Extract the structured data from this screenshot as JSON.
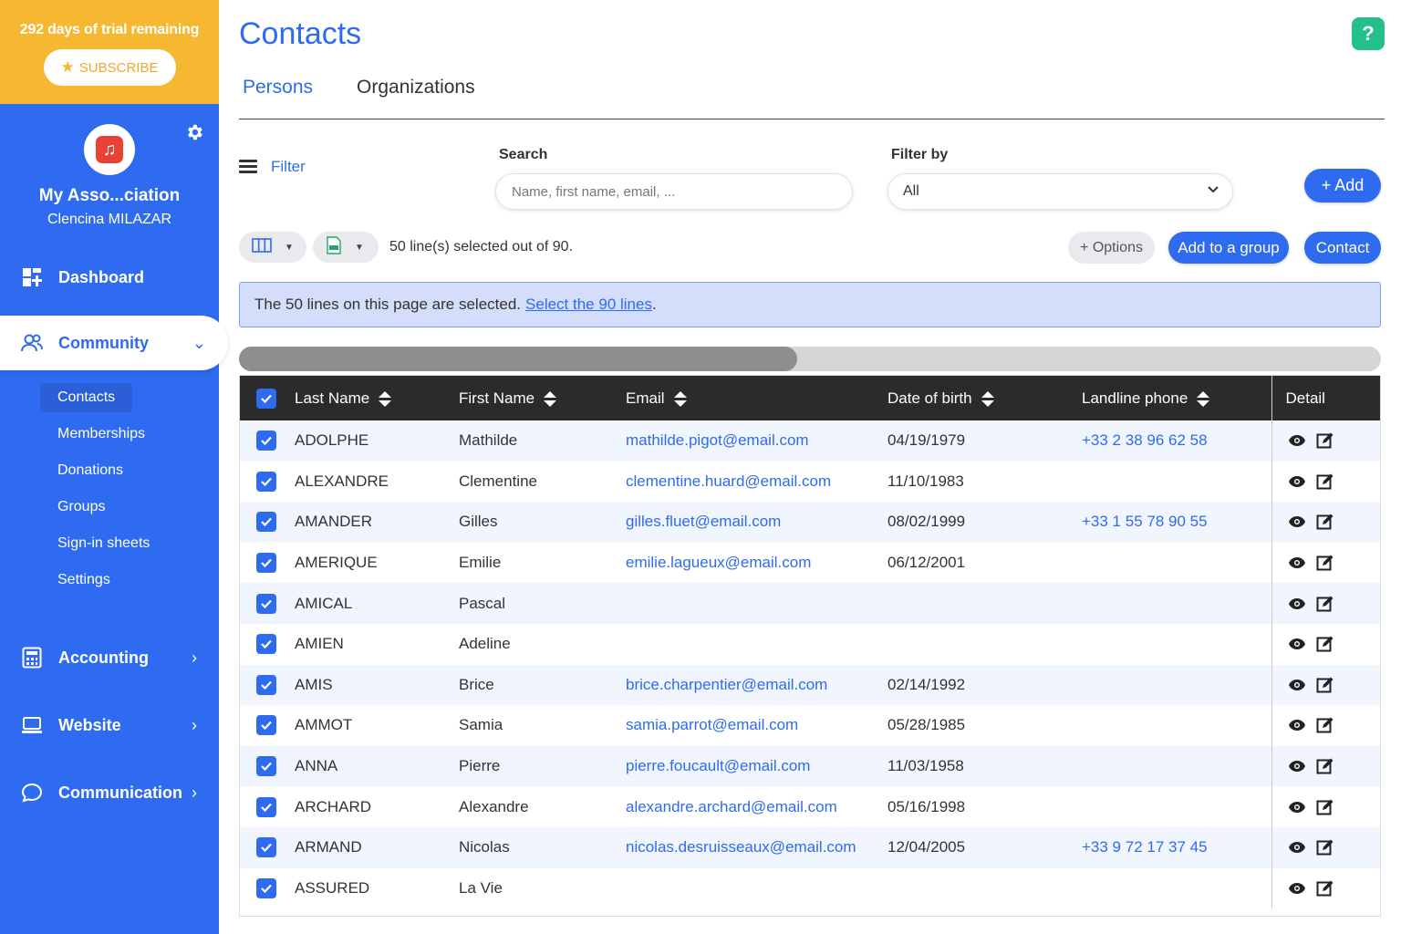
{
  "sidebar": {
    "trial_text": "292 days of trial remaining",
    "subscribe_label": "SUBSCRIBE",
    "org_name": "My Asso...ciation",
    "org_user": "Clencina MILAZAR",
    "nav": {
      "dashboard": "Dashboard",
      "community": "Community",
      "accounting": "Accounting",
      "website": "Website",
      "communication": "Communication"
    },
    "community_items": [
      "Contacts",
      "Memberships",
      "Donations",
      "Groups",
      "Sign-in sheets",
      "Settings"
    ]
  },
  "header": {
    "title": "Contacts",
    "help_label": "?",
    "tabs": [
      "Persons",
      "Organizations"
    ]
  },
  "filters": {
    "filter_label": "Filter",
    "search_label": "Search",
    "search_placeholder": "Name, first name, email, ...",
    "filter_by_label": "Filter by",
    "filter_by_value": "All",
    "add_label": "+ Add"
  },
  "toolbar": {
    "selection_text": "50 line(s) selected out of 90.",
    "options_label": "+ Options",
    "add_to_group_label": "Add to a group",
    "contact_label": "Contact"
  },
  "banner": {
    "text": "The 50 lines on this page are selected.",
    "link": "Select the 90 lines"
  },
  "table": {
    "headers": [
      "Last Name",
      "First Name",
      "Email",
      "Date of birth",
      "Landline phone",
      "Detail"
    ],
    "rows": [
      {
        "last": "ADOLPHE",
        "first": "Mathilde",
        "email": "mathilde.pigot@email.com",
        "dob": "04/19/1979",
        "phone": "+33 2 38 96 62 58"
      },
      {
        "last": "ALEXANDRE",
        "first": "Clementine",
        "email": "clementine.huard@email.com",
        "dob": "11/10/1983",
        "phone": ""
      },
      {
        "last": "AMANDER",
        "first": "Gilles",
        "email": "gilles.fluet@email.com",
        "dob": "08/02/1999",
        "phone": "+33 1 55 78 90 55"
      },
      {
        "last": "AMERIQUE",
        "first": "Emilie",
        "email": "emilie.lagueux@email.com",
        "dob": "06/12/2001",
        "phone": ""
      },
      {
        "last": "AMICAL",
        "first": "Pascal",
        "email": "",
        "dob": "",
        "phone": ""
      },
      {
        "last": "AMIEN",
        "first": "Adeline",
        "email": "",
        "dob": "",
        "phone": ""
      },
      {
        "last": "AMIS",
        "first": "Brice",
        "email": "brice.charpentier@email.com",
        "dob": "02/14/1992",
        "phone": ""
      },
      {
        "last": "AMMOT",
        "first": "Samia",
        "email": "samia.parrot@email.com",
        "dob": "05/28/1985",
        "phone": ""
      },
      {
        "last": "ANNA",
        "first": "Pierre",
        "email": "pierre.foucault@email.com",
        "dob": "11/03/1958",
        "phone": ""
      },
      {
        "last": "ARCHARD",
        "first": "Alexandre",
        "email": "alexandre.archard@email.com",
        "dob": "05/16/1998",
        "phone": ""
      },
      {
        "last": "ARMAND",
        "first": "Nicolas",
        "email": "nicolas.desruisseaux@email.com",
        "dob": "12/04/2005",
        "phone": "+33 9 72 17 37 45"
      },
      {
        "last": "ASSURED",
        "first": "La Vie",
        "email": "",
        "dob": "",
        "phone": ""
      }
    ]
  },
  "colors": {
    "primary": "#2f6bf0",
    "trial_bg": "#f6b731",
    "help": "#23c08a",
    "table_header": "#2b2b2b"
  }
}
